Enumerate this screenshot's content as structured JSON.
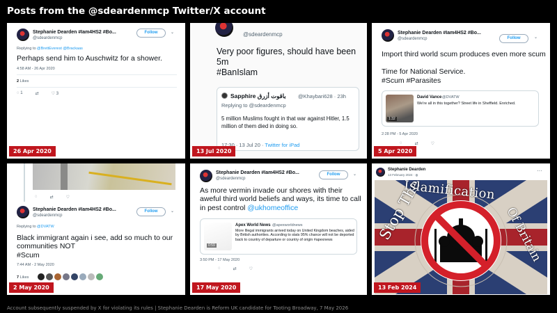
{
  "page_title": "Posts from the @sdeardenmcp Twitter/X account",
  "footer": "Account subsequently suspended by X for violating its rules  |  Stephanie Dearden is Reform UK candidate for Tooting Broadway, 7 May 2026",
  "colors": {
    "date_badge": "#c0161e",
    "twitter_blue": "#1d9bf0",
    "background": "#000000"
  },
  "posts": [
    {
      "date": "26 Apr 2020",
      "name": "Stephanie Dearden #Iam4HS2 #Bo...",
      "handle": "@sdeardenmcp",
      "follow": "Follow",
      "reply_prefix": "Replying to ",
      "reply_to": "@BrettEverest @Brackaas",
      "text": "Perhaps send him to Auschwitz for a shower.",
      "time": "4:58 AM - 26 Apr 2020",
      "likes_count": "2",
      "likes_label": "Likes",
      "reply_count": "1",
      "like_count": "3"
    },
    {
      "date": "13 Jul 2020",
      "handle": "@sdeardenmcp",
      "text": "Very poor figures, should have been 5m",
      "hashtag": "#BanIslam",
      "quote_name": "Sapphire باقوت أزرق",
      "quote_handle": "@Khaybari628 · 23h",
      "quote_reply": "Replying to @sdeardenmcp",
      "quote_text": "5 million Muslims fought in that war against Hitler, 1.5 million of them died in doing so.",
      "quote_time": "17:30 · 13 Jul 20 · ",
      "quote_app": "Twitter for iPad"
    },
    {
      "date": "5 Apr 2020",
      "name": "Stephanie Dearden #Iam4HS2 #Bo...",
      "handle": "@sdeardenmcp",
      "follow": "Follow",
      "text": "Import third world scum produces even more scum",
      "text2": "Time for National Service.",
      "hashtags": "#Scum #Parasites",
      "quote_name": "David Vance",
      "quote_handle": "@DVATW",
      "quote_text": "We're all in this together? Street life in Sheffield. Enriched.",
      "video_time": "1:32",
      "time": "2:28 PM - 5 Apr 2020"
    },
    {
      "date": "2 May 2020",
      "name": "Stephanie Dearden #Iam4HS2 #Bo...",
      "handle": "@sdeardenmcp",
      "follow": "Follow",
      "reply_prefix": "Replying to ",
      "reply_to": "@DVATW",
      "text": "Black immigrant again i see, add so much to our communities NOT",
      "hashtag": "#Scum",
      "time": "7:44 AM - 2 May 2020",
      "likes_count": "7",
      "likes_label": "Likes"
    },
    {
      "date": "17 May 2020",
      "name": "Stephanie Dearden #Iam4HS2 #Bo...",
      "handle": "@sdeardenmcp",
      "follow": "Follow",
      "text": "As more vermin invade our shores with their aweful third world beliefs and ways, its time to call in pest control ",
      "mention": "@ukhomeoffice",
      "quote_name": "Apex World News",
      "quote_handle": "@apexworldnews",
      "quote_text": "More Illegal immigrants arrived today on United Kingdom beaches, aided by British authorities. According to stats 95% chance will not be deported back to country of departure or country of origin #apexnews",
      "video_time": "0:59",
      "time": "3:50 PM - 17 May 2020"
    },
    {
      "date": "13 Feb 2024",
      "name": "Stephanie Dearden",
      "meta": "13 February 2024 · ",
      "more": "···",
      "banner_text_left": "Stop The",
      "banner_text_top": "Islamification",
      "banner_text_right": "Of Britain"
    }
  ],
  "icons": [
    "reply-icon",
    "retweet-icon",
    "heart-icon",
    "chevron-down-icon",
    "globe-icon",
    "more-icon"
  ]
}
